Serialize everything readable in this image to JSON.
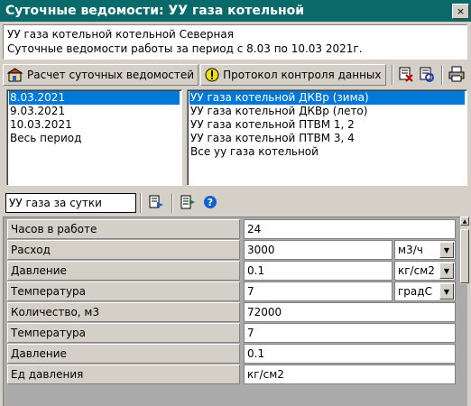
{
  "window": {
    "title": "Суточные ведомости: УУ газа котельной",
    "close_glyph": "×"
  },
  "info": {
    "line1": "УУ газа котельной котельной  Северная",
    "line2": "Суточные ведомости работы за период с 8.03 по 10.03  2021г."
  },
  "toolbar": {
    "calc_label": "Расчет суточных ведомостей",
    "protocol_label": "Протокол контроля данных"
  },
  "dates": [
    {
      "label": "8.03.2021",
      "selected": true
    },
    {
      "label": "9.03.2021",
      "selected": false
    },
    {
      "label": "10.03.2021",
      "selected": false
    },
    {
      "label": "Весь период",
      "selected": false
    }
  ],
  "meters": [
    {
      "label": "УУ газа котельной ДКВр (зима)",
      "selected": true
    },
    {
      "label": "УУ газа котельной ДКВр (лето)",
      "selected": false
    },
    {
      "label": "УУ газа котельной ПТВМ 1, 2",
      "selected": false
    },
    {
      "label": "УУ газа котельной ПТВМ 3, 4",
      "selected": false
    },
    {
      "label": "Все уу газа котельной",
      "selected": false
    }
  ],
  "report": {
    "combo_value": "УУ газа за сутки"
  },
  "rows": [
    {
      "label": "Часов в работе",
      "value": "24",
      "unit": ""
    },
    {
      "label": "Расход",
      "value": "3000",
      "unit": "м3/ч"
    },
    {
      "label": "Давление",
      "value": "0.1",
      "unit": "кг/см2"
    },
    {
      "label": "Температура",
      "value": "7",
      "unit": "градС"
    },
    {
      "label": "Количество, м3",
      "value": "72000",
      "unit": ""
    },
    {
      "label": "Температура",
      "value": "7",
      "unit": ""
    },
    {
      "label": "Давление",
      "value": "0.1",
      "unit": ""
    },
    {
      "label": "Ед давления",
      "value": "кг/см2",
      "unit": ""
    }
  ],
  "colors": {
    "titlebar": "#0a6a6a",
    "selection": "#0078d7"
  }
}
